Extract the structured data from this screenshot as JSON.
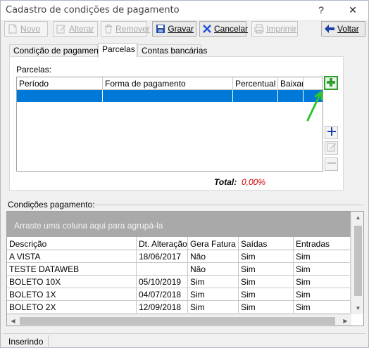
{
  "window": {
    "title": "Cadastro de condições de pagamento",
    "help_glyph": "?",
    "close_glyph": "✕"
  },
  "toolbar": {
    "novo": "Novo",
    "alterar": "Alterar",
    "remover": "Remover",
    "gravar": "Gravar",
    "cancelar": "Cancelar",
    "imprimir": "Imprimir",
    "voltar": "Voltar"
  },
  "tabs": [
    "Condição de pagamento",
    "Parcelas",
    "Contas bancárias"
  ],
  "parcelas": {
    "label": "Parcelas:",
    "columns": [
      "Período",
      "Forma de pagamento",
      "Percentual",
      "Baixar"
    ],
    "total_label": "Total:",
    "total_value": "0,00%"
  },
  "conditions": {
    "label": "Condições pagamento:",
    "group_hint": "Arraste uma coluna aqui para agrupá-la",
    "columns": [
      "Descrição",
      "Dt. Alteração",
      "Gera Fatura",
      "Saídas",
      "Entradas"
    ],
    "rows": [
      [
        "A VISTA",
        "18/06/2017",
        "Não",
        "Sim",
        "Sim"
      ],
      [
        "TESTE DATAWEB",
        "",
        "Não",
        "Sim",
        "Sim"
      ],
      [
        "BOLETO  10X",
        "05/10/2019",
        "Sim",
        "Sim",
        "Sim"
      ],
      [
        "BOLETO  1X",
        "04/07/2018",
        "Sim",
        "Sim",
        "Sim"
      ],
      [
        "BOLETO  2X",
        "12/09/2018",
        "Sim",
        "Sim",
        "Sim"
      ]
    ]
  },
  "status": {
    "text": "Inserindo"
  },
  "colors": {
    "selection": "#0078d7",
    "total_value": "#d20000",
    "add_icon": "#2e9e2e",
    "arrow_annotation": "#2fc42f"
  }
}
